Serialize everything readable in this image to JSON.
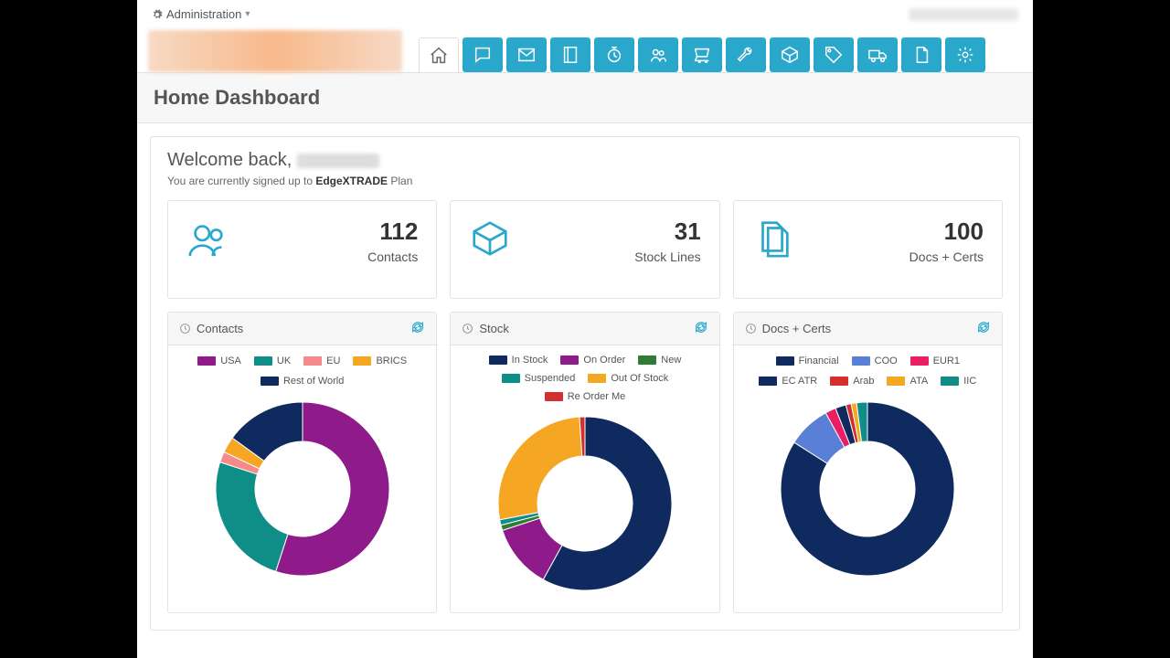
{
  "topbar": {
    "admin_label": "Administration"
  },
  "page_title": "Home Dashboard",
  "welcome": {
    "prefix": "Welcome back, ",
    "plan_prefix": "You are currently signed up to ",
    "plan_name": "EdgeXTRADE",
    "plan_suffix": " Plan"
  },
  "stats": {
    "contacts": {
      "value": "112",
      "label": "Contacts"
    },
    "stock": {
      "value": "31",
      "label": "Stock Lines"
    },
    "docs": {
      "value": "100",
      "label": "Docs + Certs"
    }
  },
  "chart_headers": {
    "contacts": "Contacts",
    "stock": "Stock",
    "docs": "Docs + Certs"
  },
  "chart_data": [
    {
      "type": "pie",
      "title": "Contacts",
      "series": [
        {
          "name": "USA",
          "value": 55,
          "color": "#8f1a8a"
        },
        {
          "name": "UK",
          "value": 25,
          "color": "#0f8e87"
        },
        {
          "name": "EU",
          "value": 2,
          "color": "#f48a8a"
        },
        {
          "name": "BRICS",
          "value": 3,
          "color": "#f5a623"
        },
        {
          "name": "Rest of World",
          "value": 15,
          "color": "#0f2a5e"
        }
      ]
    },
    {
      "type": "pie",
      "title": "Stock",
      "series": [
        {
          "name": "In Stock",
          "value": 58,
          "color": "#0f2a5e"
        },
        {
          "name": "On Order",
          "value": 12,
          "color": "#8f1a8a"
        },
        {
          "name": "New",
          "value": 1,
          "color": "#2e7d32"
        },
        {
          "name": "Suspended",
          "value": 1,
          "color": "#0f8e87"
        },
        {
          "name": "Out Of Stock",
          "value": 27,
          "color": "#f5a623"
        },
        {
          "name": "Re Order Me",
          "value": 1,
          "color": "#d32f2f"
        }
      ]
    },
    {
      "type": "pie",
      "title": "Docs + Certs",
      "series": [
        {
          "name": "Financial",
          "value": 84,
          "color": "#0f2a5e"
        },
        {
          "name": "COO",
          "value": 8,
          "color": "#5a7fd6"
        },
        {
          "name": "EUR1",
          "value": 2,
          "color": "#e91e63"
        },
        {
          "name": "EC ATR",
          "value": 2,
          "color": "#0f2a5e"
        },
        {
          "name": "Arab",
          "value": 1,
          "color": "#d32f2f"
        },
        {
          "name": "ATA",
          "value": 1,
          "color": "#f5a623"
        },
        {
          "name": "IIC",
          "value": 2,
          "color": "#0f8e87"
        }
      ]
    }
  ],
  "nav_icons": [
    "home",
    "chat",
    "mail",
    "book",
    "clock",
    "users",
    "cart",
    "wrench",
    "package",
    "tag",
    "truck",
    "doc",
    "gear"
  ]
}
